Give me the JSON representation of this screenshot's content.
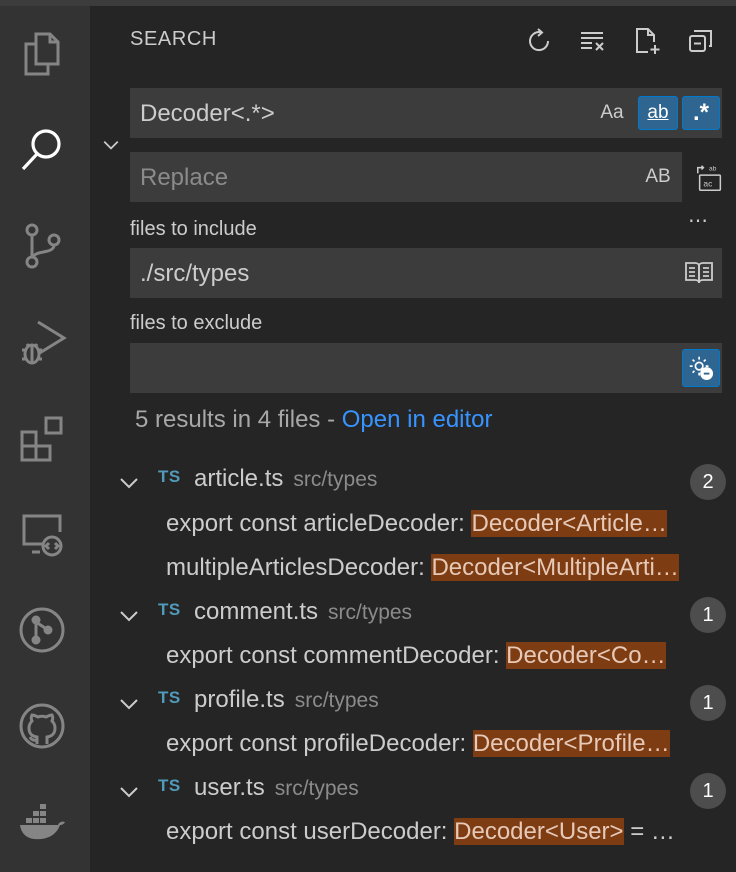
{
  "panel": {
    "title": "SEARCH",
    "actions": [
      "refresh-icon",
      "clear-results-icon",
      "new-search-editor-icon",
      "collapse-all-icon"
    ]
  },
  "search": {
    "value": "Decoder<.*>",
    "match_case_label": "Aa",
    "whole_word_label": "ab",
    "regex_label": ".*",
    "whole_word_on": true,
    "regex_on": true
  },
  "replace": {
    "placeholder": "Replace",
    "preserve_case_label": "AB"
  },
  "include": {
    "label": "files to include",
    "value": "./src/types"
  },
  "exclude": {
    "label": "files to exclude",
    "value": ""
  },
  "summary": {
    "text": "5 results in 4 files - ",
    "link": "Open in editor"
  },
  "results": [
    {
      "lang": "TS",
      "file": "article.ts",
      "path": "src/types",
      "count": "2",
      "matches": [
        {
          "before": "export const articleDecoder: ",
          "match": "Decoder<Article…"
        },
        {
          "before": "multipleArticlesDecoder: ",
          "match": "Decoder<MultipleArti…"
        }
      ]
    },
    {
      "lang": "TS",
      "file": "comment.ts",
      "path": "src/types",
      "count": "1",
      "matches": [
        {
          "before": "export const commentDecoder: ",
          "match": "Decoder<Co…"
        }
      ]
    },
    {
      "lang": "TS",
      "file": "profile.ts",
      "path": "src/types",
      "count": "1",
      "matches": [
        {
          "before": "export const profileDecoder: ",
          "match": "Decoder<Profile…"
        }
      ]
    },
    {
      "lang": "TS",
      "file": "user.ts",
      "path": "src/types",
      "count": "1",
      "matches": [
        {
          "before": "export const userDecoder: ",
          "match": "Decoder<User>",
          "after": " = …"
        }
      ]
    }
  ],
  "activity_bar": [
    "explorer-icon",
    "search-icon",
    "source-control-icon",
    "run-debug-icon",
    "extensions-icon",
    "remote-explorer-icon",
    "git-graph-icon",
    "github-icon",
    "docker-icon"
  ],
  "colors": {
    "activity_bar": "#333333",
    "side_bar": "#252526",
    "input": "#3c3c3c",
    "link": "#3794ff",
    "match_highlight": "#7e3c12",
    "ts_icon": "#519aba",
    "option_active": "#2f6591"
  }
}
